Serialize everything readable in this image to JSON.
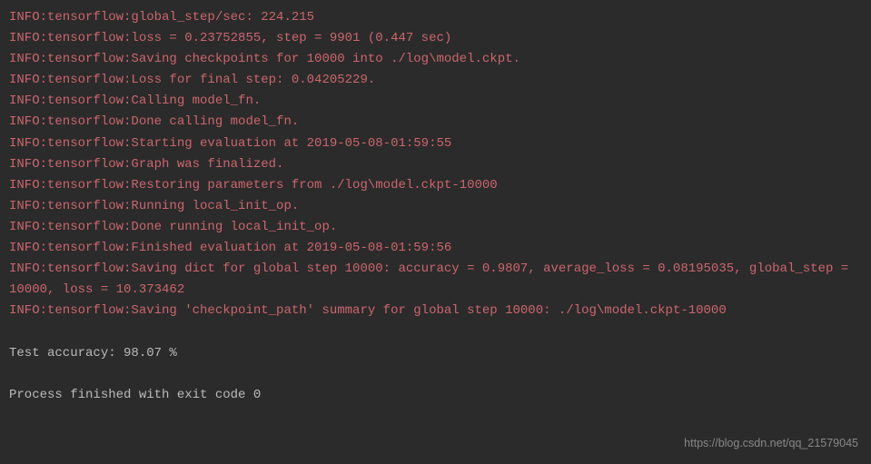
{
  "lines": [
    {
      "cls": "info-line",
      "text": "INFO:tensorflow:global_step/sec: 224.215"
    },
    {
      "cls": "info-line",
      "text": "INFO:tensorflow:loss = 0.23752855, step = 9901 (0.447 sec)"
    },
    {
      "cls": "info-line",
      "text": "INFO:tensorflow:Saving checkpoints for 10000 into ./log\\model.ckpt."
    },
    {
      "cls": "info-line",
      "text": "INFO:tensorflow:Loss for final step: 0.04205229."
    },
    {
      "cls": "info-line",
      "text": "INFO:tensorflow:Calling model_fn."
    },
    {
      "cls": "info-line",
      "text": "INFO:tensorflow:Done calling model_fn."
    },
    {
      "cls": "info-line",
      "text": "INFO:tensorflow:Starting evaluation at 2019-05-08-01:59:55"
    },
    {
      "cls": "info-line",
      "text": "INFO:tensorflow:Graph was finalized."
    },
    {
      "cls": "info-line",
      "text": "INFO:tensorflow:Restoring parameters from ./log\\model.ckpt-10000"
    },
    {
      "cls": "info-line",
      "text": "INFO:tensorflow:Running local_init_op."
    },
    {
      "cls": "info-line",
      "text": "INFO:tensorflow:Done running local_init_op."
    },
    {
      "cls": "info-line",
      "text": "INFO:tensorflow:Finished evaluation at 2019-05-08-01:59:56"
    },
    {
      "cls": "info-line",
      "text": "INFO:tensorflow:Saving dict for global step 10000: accuracy = 0.9807, average_loss = 0.08195035, global_step = 10000, loss = 10.373462"
    },
    {
      "cls": "info-line",
      "text": "INFO:tensorflow:Saving 'checkpoint_path' summary for global step 10000: ./log\\model.ckpt-10000"
    },
    {
      "cls": "blank-line",
      "text": ""
    },
    {
      "cls": "normal-line",
      "text": "Test accuracy: 98.07 %"
    },
    {
      "cls": "blank-line",
      "text": ""
    },
    {
      "cls": "normal-line",
      "text": "Process finished with exit code 0"
    }
  ],
  "watermark": "https://blog.csdn.net/qq_21579045"
}
